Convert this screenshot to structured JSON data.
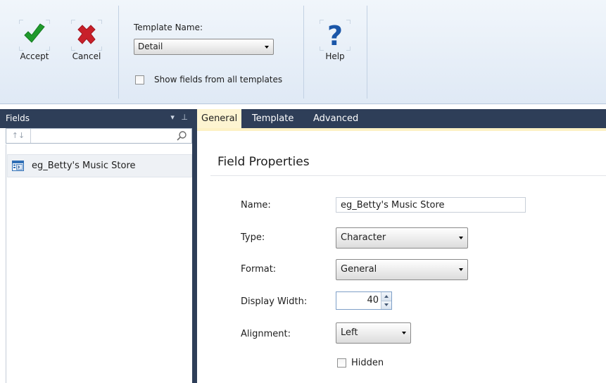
{
  "ribbon": {
    "accept_label": "Accept",
    "cancel_label": "Cancel",
    "template_name_label": "Template Name:",
    "template_value": "Detail",
    "show_all_label": "Show fields from all templates",
    "show_all_checked": false,
    "help_label": "Help"
  },
  "fields_panel": {
    "title": "Fields",
    "search_placeholder": "",
    "items": [
      {
        "label": "eg_Betty's Music Store"
      }
    ]
  },
  "tabs": [
    {
      "label": "General",
      "active": true
    },
    {
      "label": "Template",
      "active": false
    },
    {
      "label": "Advanced",
      "active": false
    }
  ],
  "properties": {
    "title": "Field Properties",
    "name_label": "Name:",
    "name_value": "eg_Betty's Music Store",
    "type_label": "Type:",
    "type_value": "Character",
    "format_label": "Format:",
    "format_value": "General",
    "width_label": "Display Width:",
    "width_value": "40",
    "alignment_label": "Alignment:",
    "alignment_value": "Left",
    "hidden_label": "Hidden",
    "hidden_checked": false
  },
  "colors": {
    "accept_green": "#1f9a2c",
    "cancel_red": "#c8202a",
    "help_blue": "#1a56a8",
    "panel_header": "#2e3e58",
    "active_tab": "#fdf4d1"
  }
}
